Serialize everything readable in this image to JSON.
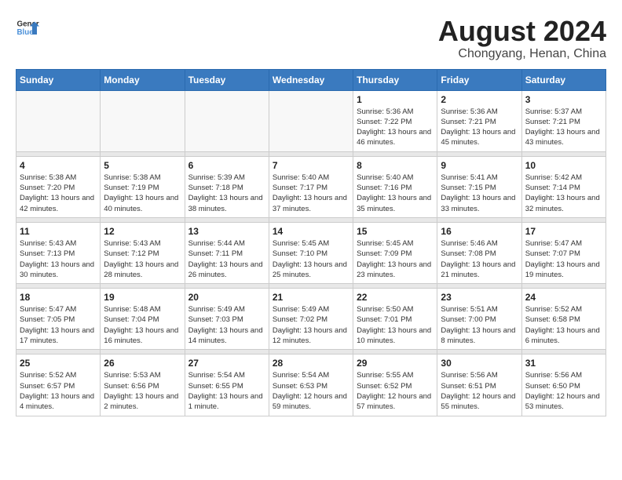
{
  "header": {
    "logo_line1": "General",
    "logo_line2": "Blue",
    "month": "August 2024",
    "location": "Chongyang, Henan, China"
  },
  "weekdays": [
    "Sunday",
    "Monday",
    "Tuesday",
    "Wednesday",
    "Thursday",
    "Friday",
    "Saturday"
  ],
  "weeks": [
    [
      {
        "day": "",
        "empty": true
      },
      {
        "day": "",
        "empty": true
      },
      {
        "day": "",
        "empty": true
      },
      {
        "day": "",
        "empty": true
      },
      {
        "day": "1",
        "sunrise": "5:36 AM",
        "sunset": "7:22 PM",
        "daylight": "13 hours and 46 minutes."
      },
      {
        "day": "2",
        "sunrise": "5:36 AM",
        "sunset": "7:21 PM",
        "daylight": "13 hours and 45 minutes."
      },
      {
        "day": "3",
        "sunrise": "5:37 AM",
        "sunset": "7:21 PM",
        "daylight": "13 hours and 43 minutes."
      }
    ],
    [
      {
        "day": "4",
        "sunrise": "5:38 AM",
        "sunset": "7:20 PM",
        "daylight": "13 hours and 42 minutes."
      },
      {
        "day": "5",
        "sunrise": "5:38 AM",
        "sunset": "7:19 PM",
        "daylight": "13 hours and 40 minutes."
      },
      {
        "day": "6",
        "sunrise": "5:39 AM",
        "sunset": "7:18 PM",
        "daylight": "13 hours and 38 minutes."
      },
      {
        "day": "7",
        "sunrise": "5:40 AM",
        "sunset": "7:17 PM",
        "daylight": "13 hours and 37 minutes."
      },
      {
        "day": "8",
        "sunrise": "5:40 AM",
        "sunset": "7:16 PM",
        "daylight": "13 hours and 35 minutes."
      },
      {
        "day": "9",
        "sunrise": "5:41 AM",
        "sunset": "7:15 PM",
        "daylight": "13 hours and 33 minutes."
      },
      {
        "day": "10",
        "sunrise": "5:42 AM",
        "sunset": "7:14 PM",
        "daylight": "13 hours and 32 minutes."
      }
    ],
    [
      {
        "day": "11",
        "sunrise": "5:43 AM",
        "sunset": "7:13 PM",
        "daylight": "13 hours and 30 minutes."
      },
      {
        "day": "12",
        "sunrise": "5:43 AM",
        "sunset": "7:12 PM",
        "daylight": "13 hours and 28 minutes."
      },
      {
        "day": "13",
        "sunrise": "5:44 AM",
        "sunset": "7:11 PM",
        "daylight": "13 hours and 26 minutes."
      },
      {
        "day": "14",
        "sunrise": "5:45 AM",
        "sunset": "7:10 PM",
        "daylight": "13 hours and 25 minutes."
      },
      {
        "day": "15",
        "sunrise": "5:45 AM",
        "sunset": "7:09 PM",
        "daylight": "13 hours and 23 minutes."
      },
      {
        "day": "16",
        "sunrise": "5:46 AM",
        "sunset": "7:08 PM",
        "daylight": "13 hours and 21 minutes."
      },
      {
        "day": "17",
        "sunrise": "5:47 AM",
        "sunset": "7:07 PM",
        "daylight": "13 hours and 19 minutes."
      }
    ],
    [
      {
        "day": "18",
        "sunrise": "5:47 AM",
        "sunset": "7:05 PM",
        "daylight": "13 hours and 17 minutes."
      },
      {
        "day": "19",
        "sunrise": "5:48 AM",
        "sunset": "7:04 PM",
        "daylight": "13 hours and 16 minutes."
      },
      {
        "day": "20",
        "sunrise": "5:49 AM",
        "sunset": "7:03 PM",
        "daylight": "13 hours and 14 minutes."
      },
      {
        "day": "21",
        "sunrise": "5:49 AM",
        "sunset": "7:02 PM",
        "daylight": "13 hours and 12 minutes."
      },
      {
        "day": "22",
        "sunrise": "5:50 AM",
        "sunset": "7:01 PM",
        "daylight": "13 hours and 10 minutes."
      },
      {
        "day": "23",
        "sunrise": "5:51 AM",
        "sunset": "7:00 PM",
        "daylight": "13 hours and 8 minutes."
      },
      {
        "day": "24",
        "sunrise": "5:52 AM",
        "sunset": "6:58 PM",
        "daylight": "13 hours and 6 minutes."
      }
    ],
    [
      {
        "day": "25",
        "sunrise": "5:52 AM",
        "sunset": "6:57 PM",
        "daylight": "13 hours and 4 minutes."
      },
      {
        "day": "26",
        "sunrise": "5:53 AM",
        "sunset": "6:56 PM",
        "daylight": "13 hours and 2 minutes."
      },
      {
        "day": "27",
        "sunrise": "5:54 AM",
        "sunset": "6:55 PM",
        "daylight": "13 hours and 1 minute."
      },
      {
        "day": "28",
        "sunrise": "5:54 AM",
        "sunset": "6:53 PM",
        "daylight": "12 hours and 59 minutes."
      },
      {
        "day": "29",
        "sunrise": "5:55 AM",
        "sunset": "6:52 PM",
        "daylight": "12 hours and 57 minutes."
      },
      {
        "day": "30",
        "sunrise": "5:56 AM",
        "sunset": "6:51 PM",
        "daylight": "12 hours and 55 minutes."
      },
      {
        "day": "31",
        "sunrise": "5:56 AM",
        "sunset": "6:50 PM",
        "daylight": "12 hours and 53 minutes."
      }
    ]
  ]
}
